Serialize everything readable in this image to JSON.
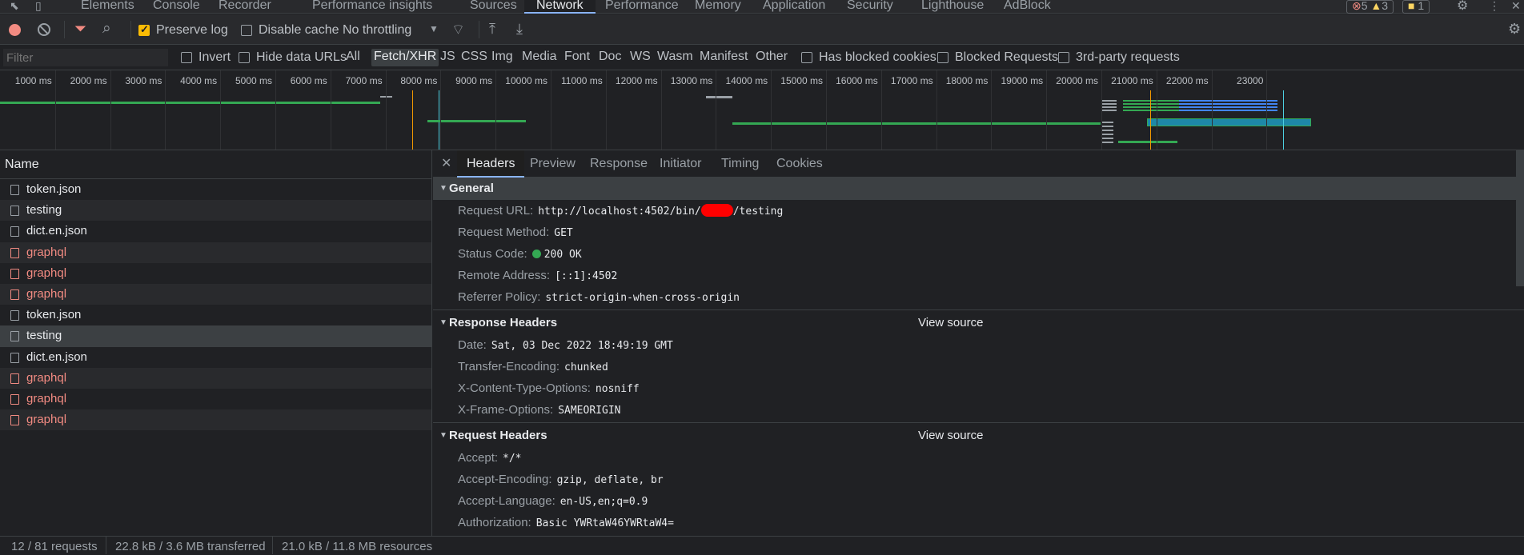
{
  "tabs": [
    "Elements",
    "Console",
    "Recorder",
    "Performance insights",
    "Sources",
    "Network",
    "Performance",
    "Memory",
    "Application",
    "Security",
    "Lighthouse",
    "AdBlock"
  ],
  "badges": {
    "errors": "5",
    "warnings": "3",
    "issues": "1"
  },
  "toolbar": {
    "preserve_log": "Preserve log",
    "disable_cache": "Disable cache",
    "throttling": "No throttling"
  },
  "filter": {
    "placeholder": "Filter",
    "invert": "Invert",
    "hide_data_urls": "Hide data URLs",
    "types": [
      "All",
      "Fetch/XHR",
      "JS",
      "CSS",
      "Img",
      "Media",
      "Font",
      "Doc",
      "WS",
      "Wasm",
      "Manifest",
      "Other"
    ],
    "active_type": "Fetch/XHR",
    "has_blocked_cookies": "Has blocked cookies",
    "blocked_requests": "Blocked Requests",
    "third_party": "3rd-party requests"
  },
  "overview": {
    "ticks": [
      "1000 ms",
      "2000 ms",
      "3000 ms",
      "4000 ms",
      "5000 ms",
      "6000 ms",
      "7000 ms",
      "8000 ms",
      "9000 ms",
      "10000 ms",
      "11000 ms",
      "12000 ms",
      "13000 ms",
      "14000 ms",
      "15000 ms",
      "16000 ms",
      "17000 ms",
      "18000 ms",
      "19000 ms",
      "20000 ms",
      "21000 ms",
      "22000 ms",
      "23000"
    ]
  },
  "name_header": "Name",
  "requests": [
    {
      "name": "token.json",
      "error": false,
      "selected": false
    },
    {
      "name": "testing",
      "error": false,
      "selected": false
    },
    {
      "name": "dict.en.json",
      "error": false,
      "selected": false
    },
    {
      "name": "graphql",
      "error": true,
      "selected": false
    },
    {
      "name": "graphql",
      "error": true,
      "selected": false
    },
    {
      "name": "graphql",
      "error": true,
      "selected": false
    },
    {
      "name": "token.json",
      "error": false,
      "selected": false
    },
    {
      "name": "testing",
      "error": false,
      "selected": true
    },
    {
      "name": "dict.en.json",
      "error": false,
      "selected": false
    },
    {
      "name": "graphql",
      "error": true,
      "selected": false
    },
    {
      "name": "graphql",
      "error": true,
      "selected": false
    },
    {
      "name": "graphql",
      "error": true,
      "selected": false
    }
  ],
  "summary": {
    "requests": "12 / 81 requests",
    "transferred": "22.8 kB / 3.6 MB transferred",
    "resources": "21.0 kB / 11.8 MB resources"
  },
  "detail_tabs": [
    "Headers",
    "Preview",
    "Response",
    "Initiator",
    "Timing",
    "Cookies"
  ],
  "general": {
    "title": "General",
    "url_key": "Request URL:",
    "url_prefix": "http://localhost:4502/bin/",
    "url_suffix": "/testing",
    "method_key": "Request Method:",
    "method": "GET",
    "status_key": "Status Code:",
    "status": "200 OK",
    "remote_key": "Remote Address:",
    "remote": "[::1]:4502",
    "referrer_key": "Referrer Policy:",
    "referrer": "strict-origin-when-cross-origin"
  },
  "response_headers": {
    "title": "Response Headers",
    "view_source": "View source",
    "items": [
      {
        "k": "Date:",
        "v": "Sat, 03 Dec 2022 18:49:19 GMT"
      },
      {
        "k": "Transfer-Encoding:",
        "v": "chunked"
      },
      {
        "k": "X-Content-Type-Options:",
        "v": "nosniff"
      },
      {
        "k": "X-Frame-Options:",
        "v": "SAMEORIGIN"
      }
    ]
  },
  "request_headers": {
    "title": "Request Headers",
    "view_source": "View source",
    "items": [
      {
        "k": "Accept:",
        "v": "*/*"
      },
      {
        "k": "Accept-Encoding:",
        "v": "gzip, deflate, br"
      },
      {
        "k": "Accept-Language:",
        "v": "en-US,en;q=0.9"
      },
      {
        "k": "Authorization:",
        "v": "Basic YWRtaW46YWRtaW4="
      }
    ]
  }
}
